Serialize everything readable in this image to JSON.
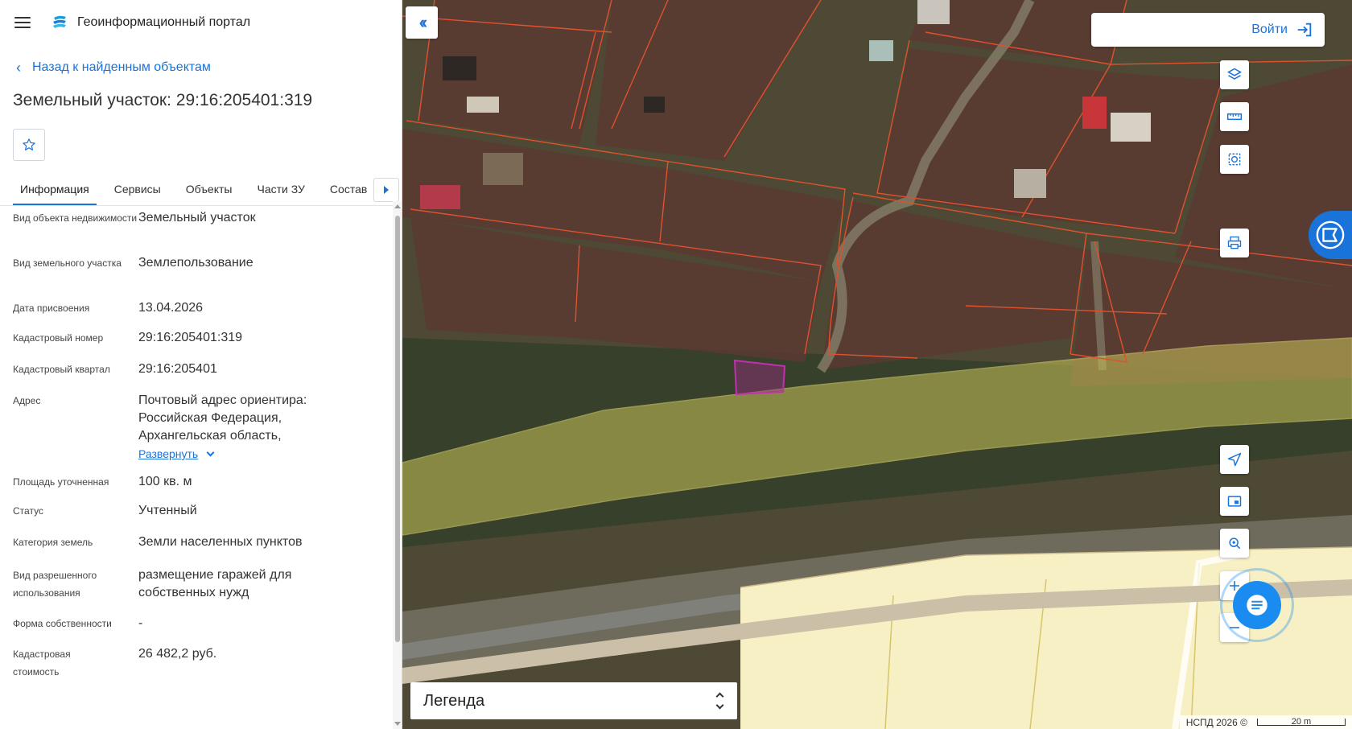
{
  "header": {
    "title": "Геоинформационный портал"
  },
  "nav": {
    "back_label": "Назад к найденным объектам"
  },
  "object": {
    "title": "Земельный участок: 29:16:205401:319"
  },
  "tabs": [
    {
      "label": "Информация",
      "active": true
    },
    {
      "label": "Сервисы",
      "active": false
    },
    {
      "label": "Объекты",
      "active": false
    },
    {
      "label": "Части ЗУ",
      "active": false
    },
    {
      "label": "Состав",
      "active": false
    }
  ],
  "info": [
    {
      "label": "Вид объекта недвижимости",
      "value": "Земельный участок"
    },
    {
      "label": "Вид земельного участка",
      "value": "Землепользование"
    },
    {
      "label": "Дата присвоения",
      "value": "13.04.2026"
    },
    {
      "label": "Кадастровый номер",
      "value": "29:16:205401:319"
    },
    {
      "label": "Кадастровый квартал",
      "value": "29:16:205401"
    },
    {
      "label": "Адрес",
      "value": "Почтовый адрес ориентира: Российская Федерация, Архангельская область,",
      "expand_label": "Развернуть"
    },
    {
      "label": "Площадь уточненная",
      "value": "100 кв. м"
    },
    {
      "label": "Статус",
      "value": "Учтенный"
    },
    {
      "label": "Категория земель",
      "value": "Земли населенных пунктов"
    },
    {
      "label": "Вид разрешенного использования",
      "value": "размещение гаражей для собственных нужд"
    },
    {
      "label": "Форма собственности",
      "value": "-"
    },
    {
      "label": "Кадастровая стоимость",
      "value": "26 482,2 руб."
    }
  ],
  "map": {
    "login_label": "Войти",
    "legend_label": "Легенда",
    "attribution": "НСПД 2026 ©",
    "scale_label": "20 m",
    "tools_top": [
      "layers-icon",
      "ruler-icon",
      "select-area-icon",
      "print-icon"
    ],
    "tools_bottom": [
      "locate-icon",
      "minimap-icon",
      "geo-search-icon",
      "zoom-in-icon",
      "zoom-out-icon"
    ]
  },
  "colors": {
    "accent": "#1a73d8",
    "parcel_border": "#e0512d",
    "selected_parcel": "#b0269e",
    "zone_fill": "#c9c45a",
    "map_base": "#4a4a33"
  }
}
